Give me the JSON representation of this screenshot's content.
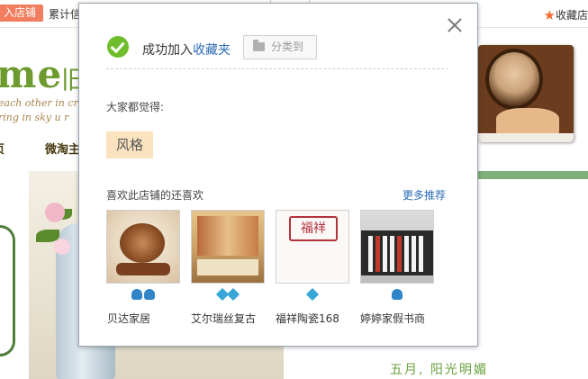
{
  "background": {
    "top_bar": {
      "enter_shop": "入店铺",
      "cumulative_text": "累计信",
      "favorite_shop": "收藏店"
    },
    "banner": {
      "logo": "me",
      "logo_cn": "旧",
      "line1": "each other in crow",
      "line2": "ring in sky    u r",
      "nav_item_1": "页",
      "nav_item_2": "微淘主"
    },
    "tagline": "五月, 阳光明媚"
  },
  "dialog": {
    "success_text": "成功加入",
    "favorites_link": "收藏夹",
    "classify_button": "分类到",
    "everyone_thinks_label": "大家都觉得:",
    "tag": "风格",
    "also_like_label": "喜欢此店铺的还喜欢",
    "more_recommend": "更多推荐",
    "shops": [
      {
        "name": "贝达家居",
        "badge": "crown",
        "badge_count": 2
      },
      {
        "name": "艾尔瑞丝复古",
        "badge": "diamond",
        "badge_count": 2
      },
      {
        "name": "福祥陶瓷168",
        "badge": "diamond",
        "badge_count": 1
      },
      {
        "name": "婷婷家假书商",
        "badge": "crown",
        "badge_count": 1
      }
    ],
    "thumb_texts": {
      "shop3_seal": "福祥"
    }
  },
  "colors": {
    "success_green": "#6fbd2c",
    "link_blue": "#2b6bb5",
    "tag_bg": "#fbe3c0",
    "enter_shop_bg": "#f07e5f",
    "star_orange": "#f46a2f"
  },
  "icons": [
    "close-icon",
    "check-icon",
    "folder-icon",
    "star-icon",
    "diamond-icon",
    "crown-icon"
  ]
}
